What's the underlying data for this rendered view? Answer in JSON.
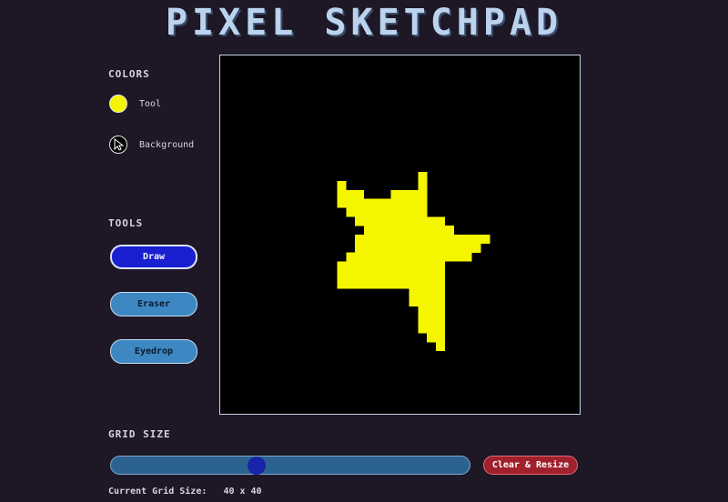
{
  "app": {
    "title": "PIXEL SKETCHPAD"
  },
  "colors": {
    "section_label": "COLORS",
    "tool_label": "Tool",
    "tool_color": "#f5f500",
    "background_label": "Background",
    "background_color": "#000000"
  },
  "tools": {
    "section_label": "TOOLS",
    "items": [
      {
        "label": "Draw",
        "active": true
      },
      {
        "label": "Eraser",
        "active": false
      },
      {
        "label": "Eyedrop",
        "active": false
      }
    ]
  },
  "canvas": {
    "grid_size": 40,
    "background": "#000000",
    "pixel_color": "#f5f500",
    "painted_rows": [
      {
        "row": 13,
        "cols": [
          22
        ]
      },
      {
        "row": 14,
        "cols": [
          13,
          22
        ]
      },
      {
        "row": 15,
        "cols": [
          13,
          14,
          15,
          19,
          20,
          21,
          22
        ]
      },
      {
        "row": 16,
        "cols": [
          13,
          14,
          15,
          16,
          17,
          18,
          19,
          20,
          21,
          22
        ]
      },
      {
        "row": 17,
        "cols": [
          14,
          15,
          16,
          17,
          18,
          19,
          20,
          21,
          22
        ]
      },
      {
        "row": 18,
        "cols": [
          15,
          16,
          17,
          18,
          19,
          20,
          21,
          22,
          23,
          24
        ]
      },
      {
        "row": 19,
        "cols": [
          16,
          17,
          18,
          19,
          20,
          21,
          22,
          23,
          24,
          25
        ]
      },
      {
        "row": 20,
        "cols": [
          15,
          16,
          17,
          18,
          19,
          20,
          21,
          22,
          23,
          24,
          25,
          26,
          27,
          28,
          29
        ]
      },
      {
        "row": 21,
        "cols": [
          15,
          16,
          17,
          18,
          19,
          20,
          21,
          22,
          23,
          24,
          25,
          26,
          27,
          28
        ]
      },
      {
        "row": 22,
        "cols": [
          14,
          15,
          16,
          17,
          18,
          19,
          20,
          21,
          22,
          23,
          24,
          25,
          26,
          27
        ]
      },
      {
        "row": 23,
        "cols": [
          13,
          14,
          15,
          16,
          17,
          18,
          19,
          20,
          21,
          22,
          23,
          24
        ]
      },
      {
        "row": 24,
        "cols": [
          13,
          14,
          15,
          16,
          17,
          18,
          19,
          20,
          21,
          22,
          23,
          24
        ]
      },
      {
        "row": 25,
        "cols": [
          13,
          14,
          15,
          16,
          17,
          18,
          19,
          20,
          21,
          22,
          23,
          24
        ]
      },
      {
        "row": 26,
        "cols": [
          21,
          22,
          23,
          24
        ]
      },
      {
        "row": 27,
        "cols": [
          21,
          22,
          23,
          24
        ]
      },
      {
        "row": 28,
        "cols": [
          22,
          23,
          24
        ]
      },
      {
        "row": 29,
        "cols": [
          22,
          23,
          24
        ]
      },
      {
        "row": 30,
        "cols": [
          22,
          23,
          24
        ]
      },
      {
        "row": 31,
        "cols": [
          23,
          24
        ]
      },
      {
        "row": 32,
        "cols": [
          24
        ]
      }
    ]
  },
  "grid": {
    "section_label": "GRID SIZE",
    "slider_fraction": 0.4,
    "clear_button_label": "Clear & Resize",
    "current_label": "Current Grid Size:",
    "current_value": "40 x 40"
  }
}
